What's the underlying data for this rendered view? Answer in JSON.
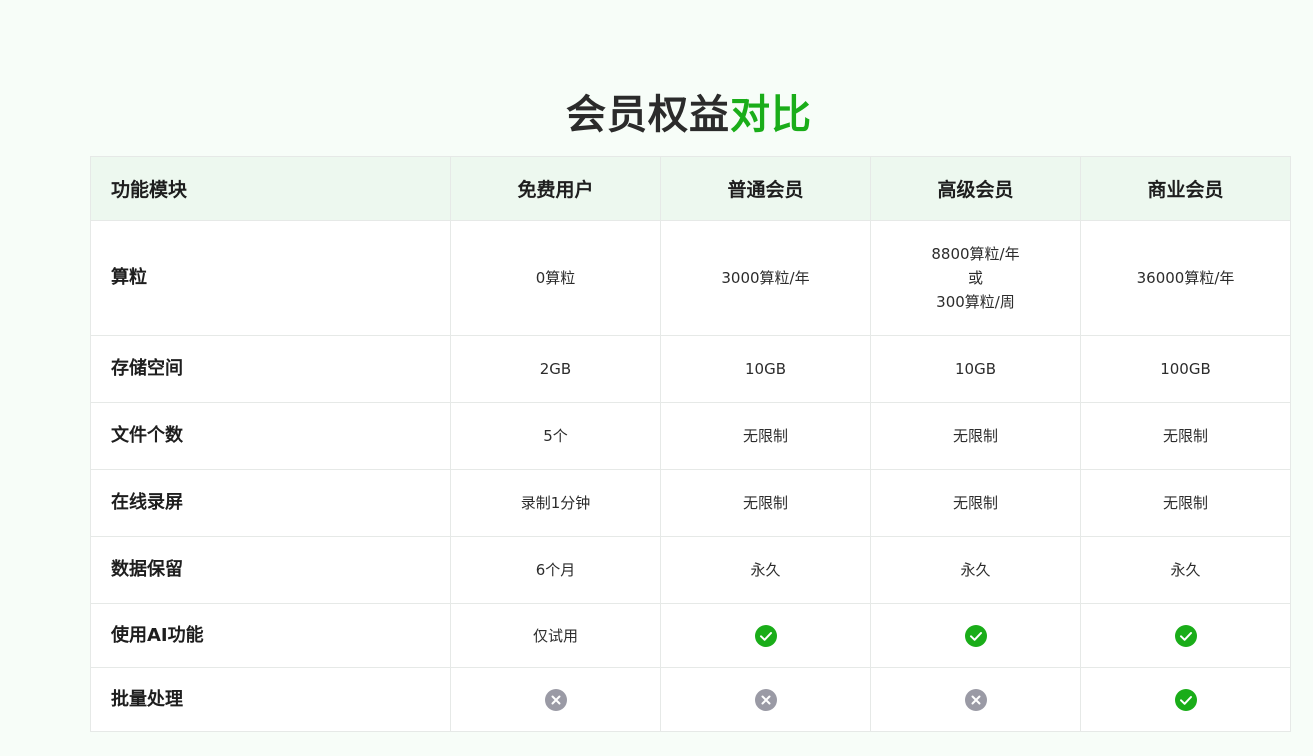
{
  "title": {
    "main": "会员权益",
    "accent": "对比"
  },
  "colors": {
    "accent": "#1aad19",
    "header_bg": "#edf8ef",
    "check": "#1aad19",
    "cross": "#9a9aa5"
  },
  "table": {
    "headers": {
      "feature": "功能模块",
      "free": "免费用户",
      "regular": "普通会员",
      "premium": "高级会员",
      "business": "商业会员"
    },
    "rows": [
      {
        "feature": "算粒",
        "free": "0算粒",
        "regular": "3000算粒/年",
        "premium_lines": [
          "8800算粒/年",
          "或",
          "300算粒/周"
        ],
        "business": "36000算粒/年"
      },
      {
        "feature": "存储空间",
        "free": "2GB",
        "regular": "10GB",
        "premium": "10GB",
        "business": "100GB"
      },
      {
        "feature": "文件个数",
        "free": "5个",
        "regular": "无限制",
        "premium": "无限制",
        "business": "无限制"
      },
      {
        "feature": "在线录屏",
        "free": "录制1分钟",
        "regular": "无限制",
        "premium": "无限制",
        "business": "无限制"
      },
      {
        "feature": "数据保留",
        "free": "6个月",
        "regular": "永久",
        "premium": "永久",
        "business": "永久"
      },
      {
        "feature": "使用AI功能",
        "free": "仅试用",
        "regular_icon": "check-icon",
        "premium_icon": "check-icon",
        "business_icon": "check-icon"
      },
      {
        "feature": "批量处理",
        "free_icon": "cross-icon",
        "regular_icon": "cross-icon",
        "premium_icon": "cross-icon",
        "business_icon": "check-icon"
      }
    ]
  }
}
